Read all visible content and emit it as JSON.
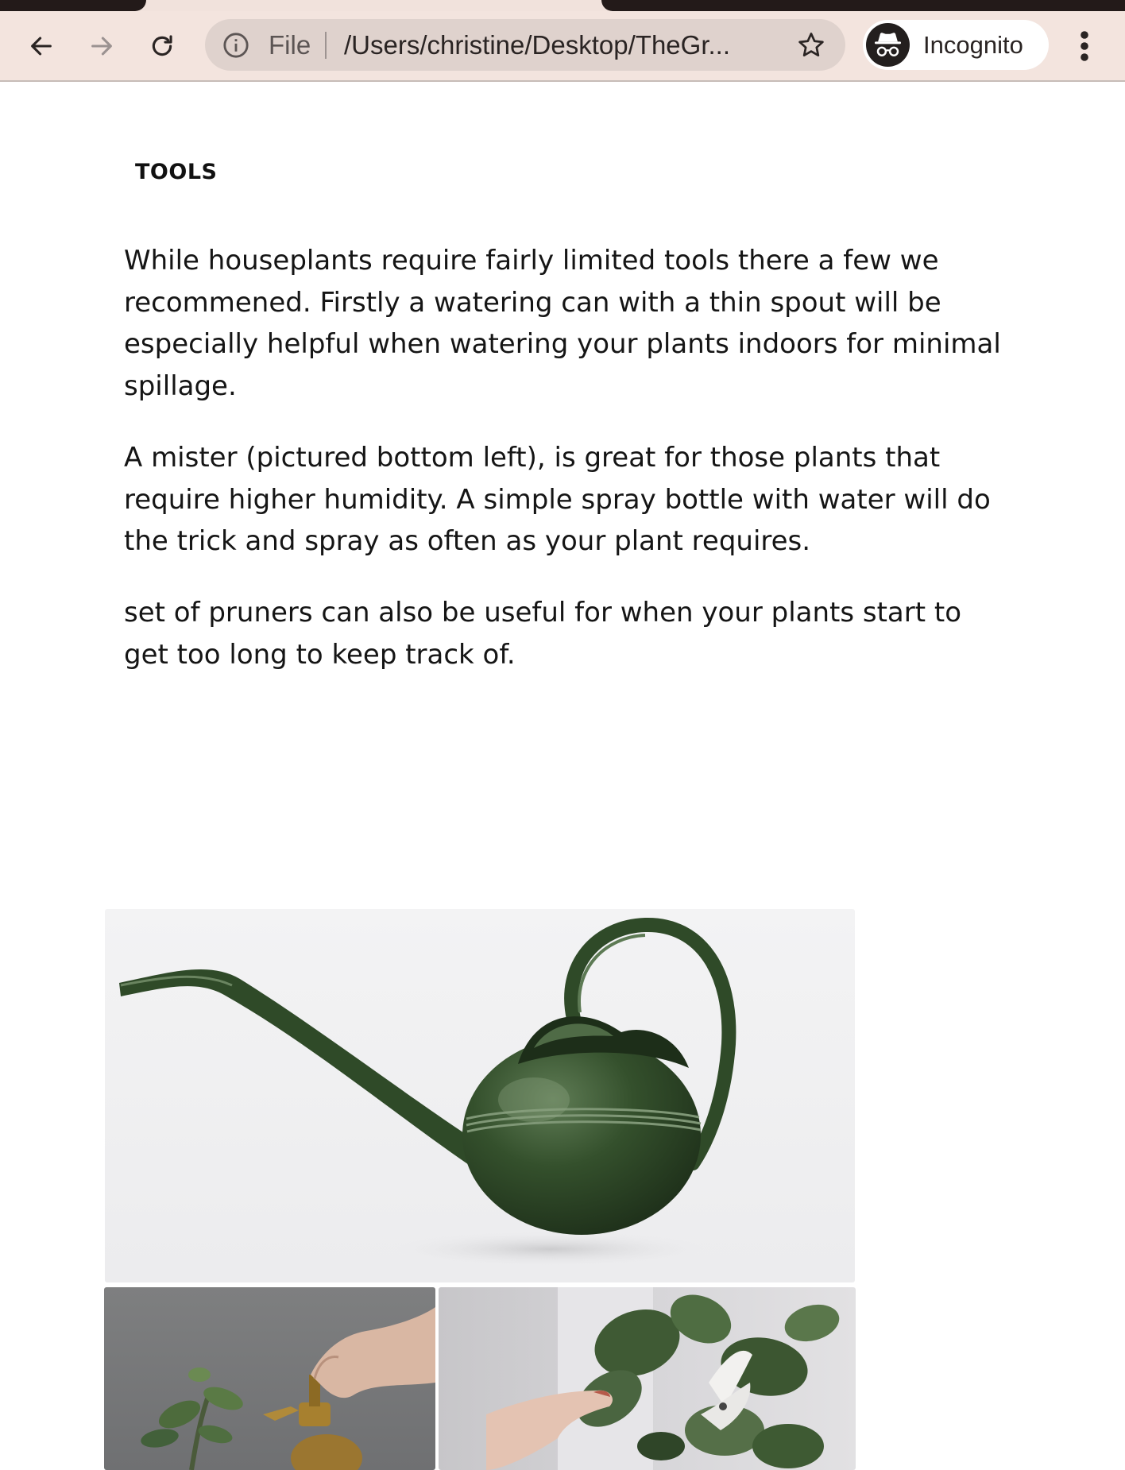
{
  "browser": {
    "omnibox": {
      "scheme_label": "File",
      "url": "/Users/christine/Desktop/TheGr..."
    },
    "incognito_label": "Incognito"
  },
  "page": {
    "section_title": "TOOLS",
    "paragraphs": [
      "While houseplants require fairly limited tools there a few we recommened. Firstly a watering can with a thin spout will be especially helpful when watering your plants indoors for minimal spillage.",
      "A mister (pictured bottom left), is great for those plants that require higher humidity. A simple spray bottle with water will do the trick and spray as often as your plant requires.",
      "set of pruners can also be useful for when your plants start to get too long to keep track of."
    ]
  },
  "colors": {
    "chrome_bg": "#f3e4de",
    "omnibox_bg": "#dfd2cd",
    "can_green": "#2f4a28"
  },
  "icons": [
    "back-icon",
    "forward-icon",
    "reload-icon",
    "info-icon",
    "star-icon",
    "incognito-icon",
    "more-vert-icon"
  ]
}
